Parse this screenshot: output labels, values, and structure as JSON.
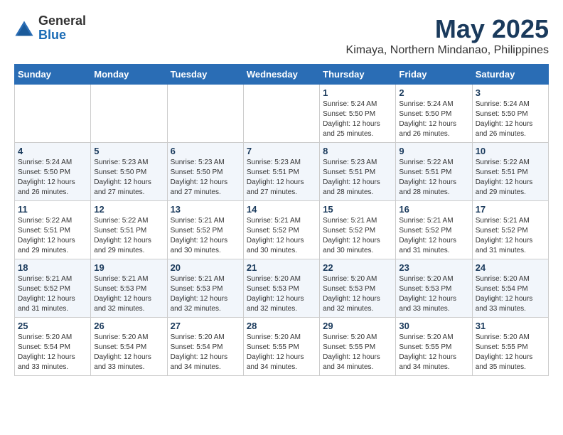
{
  "logo": {
    "general": "General",
    "blue": "Blue"
  },
  "title": "May 2025",
  "subtitle": "Kimaya, Northern Mindanao, Philippines",
  "days_of_week": [
    "Sunday",
    "Monday",
    "Tuesday",
    "Wednesday",
    "Thursday",
    "Friday",
    "Saturday"
  ],
  "weeks": [
    [
      {
        "day": "",
        "info": ""
      },
      {
        "day": "",
        "info": ""
      },
      {
        "day": "",
        "info": ""
      },
      {
        "day": "",
        "info": ""
      },
      {
        "day": "1",
        "info": "Sunrise: 5:24 AM\nSunset: 5:50 PM\nDaylight: 12 hours\nand 25 minutes."
      },
      {
        "day": "2",
        "info": "Sunrise: 5:24 AM\nSunset: 5:50 PM\nDaylight: 12 hours\nand 26 minutes."
      },
      {
        "day": "3",
        "info": "Sunrise: 5:24 AM\nSunset: 5:50 PM\nDaylight: 12 hours\nand 26 minutes."
      }
    ],
    [
      {
        "day": "4",
        "info": "Sunrise: 5:24 AM\nSunset: 5:50 PM\nDaylight: 12 hours\nand 26 minutes."
      },
      {
        "day": "5",
        "info": "Sunrise: 5:23 AM\nSunset: 5:50 PM\nDaylight: 12 hours\nand 27 minutes."
      },
      {
        "day": "6",
        "info": "Sunrise: 5:23 AM\nSunset: 5:50 PM\nDaylight: 12 hours\nand 27 minutes."
      },
      {
        "day": "7",
        "info": "Sunrise: 5:23 AM\nSunset: 5:51 PM\nDaylight: 12 hours\nand 27 minutes."
      },
      {
        "day": "8",
        "info": "Sunrise: 5:23 AM\nSunset: 5:51 PM\nDaylight: 12 hours\nand 28 minutes."
      },
      {
        "day": "9",
        "info": "Sunrise: 5:22 AM\nSunset: 5:51 PM\nDaylight: 12 hours\nand 28 minutes."
      },
      {
        "day": "10",
        "info": "Sunrise: 5:22 AM\nSunset: 5:51 PM\nDaylight: 12 hours\nand 29 minutes."
      }
    ],
    [
      {
        "day": "11",
        "info": "Sunrise: 5:22 AM\nSunset: 5:51 PM\nDaylight: 12 hours\nand 29 minutes."
      },
      {
        "day": "12",
        "info": "Sunrise: 5:22 AM\nSunset: 5:51 PM\nDaylight: 12 hours\nand 29 minutes."
      },
      {
        "day": "13",
        "info": "Sunrise: 5:21 AM\nSunset: 5:52 PM\nDaylight: 12 hours\nand 30 minutes."
      },
      {
        "day": "14",
        "info": "Sunrise: 5:21 AM\nSunset: 5:52 PM\nDaylight: 12 hours\nand 30 minutes."
      },
      {
        "day": "15",
        "info": "Sunrise: 5:21 AM\nSunset: 5:52 PM\nDaylight: 12 hours\nand 30 minutes."
      },
      {
        "day": "16",
        "info": "Sunrise: 5:21 AM\nSunset: 5:52 PM\nDaylight: 12 hours\nand 31 minutes."
      },
      {
        "day": "17",
        "info": "Sunrise: 5:21 AM\nSunset: 5:52 PM\nDaylight: 12 hours\nand 31 minutes."
      }
    ],
    [
      {
        "day": "18",
        "info": "Sunrise: 5:21 AM\nSunset: 5:52 PM\nDaylight: 12 hours\nand 31 minutes."
      },
      {
        "day": "19",
        "info": "Sunrise: 5:21 AM\nSunset: 5:53 PM\nDaylight: 12 hours\nand 32 minutes."
      },
      {
        "day": "20",
        "info": "Sunrise: 5:21 AM\nSunset: 5:53 PM\nDaylight: 12 hours\nand 32 minutes."
      },
      {
        "day": "21",
        "info": "Sunrise: 5:20 AM\nSunset: 5:53 PM\nDaylight: 12 hours\nand 32 minutes."
      },
      {
        "day": "22",
        "info": "Sunrise: 5:20 AM\nSunset: 5:53 PM\nDaylight: 12 hours\nand 32 minutes."
      },
      {
        "day": "23",
        "info": "Sunrise: 5:20 AM\nSunset: 5:53 PM\nDaylight: 12 hours\nand 33 minutes."
      },
      {
        "day": "24",
        "info": "Sunrise: 5:20 AM\nSunset: 5:54 PM\nDaylight: 12 hours\nand 33 minutes."
      }
    ],
    [
      {
        "day": "25",
        "info": "Sunrise: 5:20 AM\nSunset: 5:54 PM\nDaylight: 12 hours\nand 33 minutes."
      },
      {
        "day": "26",
        "info": "Sunrise: 5:20 AM\nSunset: 5:54 PM\nDaylight: 12 hours\nand 33 minutes."
      },
      {
        "day": "27",
        "info": "Sunrise: 5:20 AM\nSunset: 5:54 PM\nDaylight: 12 hours\nand 34 minutes."
      },
      {
        "day": "28",
        "info": "Sunrise: 5:20 AM\nSunset: 5:55 PM\nDaylight: 12 hours\nand 34 minutes."
      },
      {
        "day": "29",
        "info": "Sunrise: 5:20 AM\nSunset: 5:55 PM\nDaylight: 12 hours\nand 34 minutes."
      },
      {
        "day": "30",
        "info": "Sunrise: 5:20 AM\nSunset: 5:55 PM\nDaylight: 12 hours\nand 34 minutes."
      },
      {
        "day": "31",
        "info": "Sunrise: 5:20 AM\nSunset: 5:55 PM\nDaylight: 12 hours\nand 35 minutes."
      }
    ]
  ]
}
